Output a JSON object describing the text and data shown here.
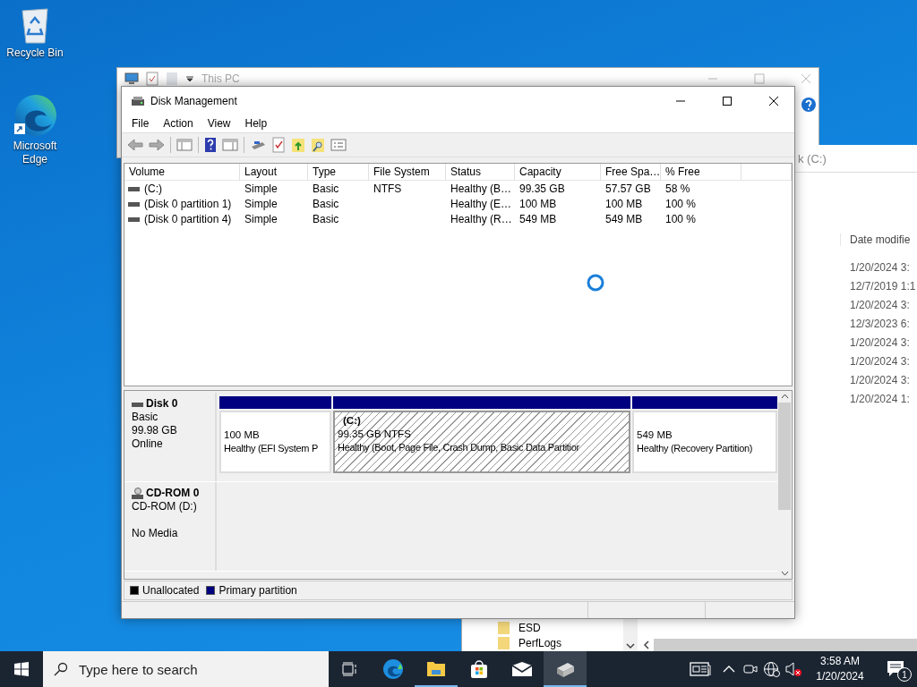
{
  "desktop_icons": [
    {
      "kind": "recycle",
      "label": "Recycle Bin"
    },
    {
      "kind": "edge",
      "label": "Microsoft Edge"
    }
  ],
  "back_window": {
    "title": "This PC"
  },
  "explorer": {
    "address": "k (C:)",
    "column": "Date modifie",
    "dates": [
      "1/20/2024 3:",
      "12/7/2019 1:1",
      "1/20/2024 3:",
      "12/3/2023 6:",
      "1/20/2024 3:",
      "1/20/2024 3:",
      "1/20/2024 3:",
      "1/20/2024 1:"
    ],
    "folders": [
      "ESD",
      "PerfLogs"
    ]
  },
  "window": {
    "title": "Disk Management",
    "menu": [
      "File",
      "Action",
      "View",
      "Help"
    ],
    "columns": [
      "Volume",
      "Layout",
      "Type",
      "File System",
      "Status",
      "Capacity",
      "Free Spa…",
      "% Free"
    ],
    "rows": [
      {
        "cells": [
          "(C:)",
          "Simple",
          "Basic",
          "NTFS",
          "Healthy (B…",
          "99.35 GB",
          "57.57 GB",
          "58 %"
        ]
      },
      {
        "cells": [
          "(Disk 0 partition 1)",
          "Simple",
          "Basic",
          "",
          "Healthy (E…",
          "100 MB",
          "100 MB",
          "100 %"
        ]
      },
      {
        "cells": [
          "(Disk 0 partition 4)",
          "Simple",
          "Basic",
          "",
          "Healthy (R…",
          "549 MB",
          "549 MB",
          "100 %"
        ]
      }
    ],
    "disks": [
      {
        "kind": "disk",
        "name": "Disk 0",
        "lines": [
          "Basic",
          "99.98 GB",
          "Online"
        ],
        "partitions": [
          {
            "size": "100 MB",
            "status": "Healthy (EFI System P",
            "color": "#000080",
            "selected": false
          },
          {
            "label": "(C:)",
            "size": "99.35 GB NTFS",
            "status": "Healthy (Boot, Page File, Crash Dump, Basic Data Partitior",
            "color": "#000080",
            "selected": true
          },
          {
            "size": "549 MB",
            "status": "Healthy (Recovery Partition)",
            "color": "#000080",
            "selected": false
          }
        ]
      },
      {
        "kind": "cdrom",
        "name": "CD-ROM 0",
        "lines": [
          "CD-ROM (D:)",
          "No Media"
        ]
      }
    ],
    "legend": [
      {
        "label": "Unallocated",
        "color": "#000000"
      },
      {
        "label": "Primary partition",
        "color": "#000080"
      }
    ]
  },
  "taskbar": {
    "search": {
      "placeholder": "Type here to search"
    },
    "apps": [
      {
        "kind": "taskview",
        "running": false,
        "active": false
      },
      {
        "kind": "edge",
        "running": false,
        "active": false
      },
      {
        "kind": "explorer",
        "running": true,
        "active": false
      },
      {
        "kind": "store",
        "running": false,
        "active": false
      },
      {
        "kind": "mail",
        "running": false,
        "active": false
      },
      {
        "kind": "diskmgmt",
        "running": true,
        "active": true
      }
    ],
    "time": "3:58 AM",
    "date": "1/20/2024",
    "notifications": "1"
  }
}
